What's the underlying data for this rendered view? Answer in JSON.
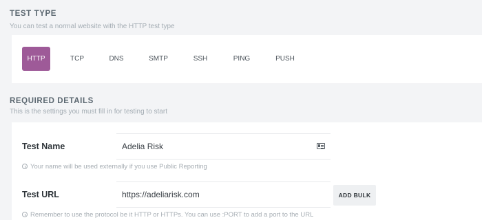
{
  "test_type": {
    "title": "TEST TYPE",
    "subtitle": "You can test a normal website with the HTTP test type",
    "tabs": [
      {
        "label": "HTTP",
        "active": true
      },
      {
        "label": "TCP",
        "active": false
      },
      {
        "label": "DNS",
        "active": false
      },
      {
        "label": "SMTP",
        "active": false
      },
      {
        "label": "SSH",
        "active": false
      },
      {
        "label": "PING",
        "active": false
      },
      {
        "label": "PUSH",
        "active": false
      }
    ],
    "active_color": "#9e5a98"
  },
  "required_details": {
    "title": "REQUIRED DETAILS",
    "subtitle": "This is the settings you must fill in for testing to start",
    "test_name": {
      "label": "Test Name",
      "value": "Adelia Risk",
      "icon": "contact-card-icon",
      "hint": "Your name will be used externally if you use Public Reporting"
    },
    "test_url": {
      "label": "Test URL",
      "value": "https://adeliarisk.com",
      "button_label": "ADD BULK",
      "hint": "Remember to use the protocol be it HTTP or HTTPs. You can use :PORT to add a port to the URL"
    }
  }
}
